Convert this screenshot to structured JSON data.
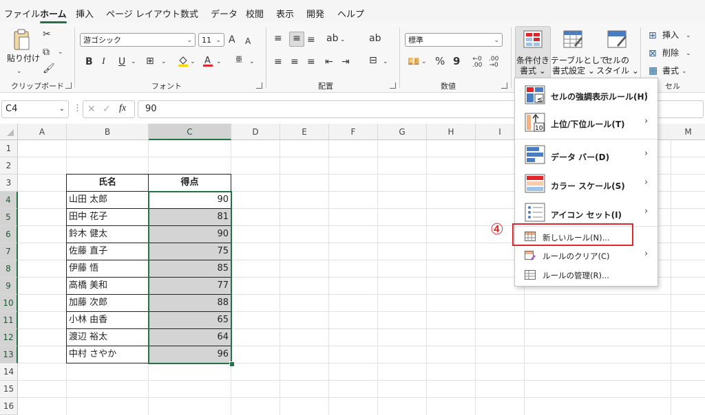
{
  "menu_tabs": [
    "ファイル",
    "ホーム",
    "挿入",
    "ページ レイアウト",
    "数式",
    "データ",
    "校閲",
    "表示",
    "開発",
    "ヘルプ"
  ],
  "active_tab": "ホーム",
  "ribbon": {
    "clipboard": {
      "paste": "貼り付け",
      "group": "クリップボード"
    },
    "font": {
      "name": "游ゴシック",
      "size": "11",
      "bold": "B",
      "italic": "I",
      "underline": "U",
      "group": "フォント",
      "grow": "A",
      "shrink": "A"
    },
    "align": {
      "group": "配置"
    },
    "number": {
      "format": "標準",
      "percent": "%",
      "comma": "9",
      "group": "数値"
    },
    "styles": {
      "cond_format_1": "条件付き",
      "cond_format_2": "書式 ⌄",
      "table_1": "テーブルとして",
      "table_2": "書式設定 ⌄",
      "cell_style_1": "セルの",
      "cell_style_2": "スタイル ⌄"
    },
    "cells": {
      "insert": "挿入",
      "delete": "削除",
      "format": "書式",
      "group": "セル"
    }
  },
  "formula_bar": {
    "name_box": "C4",
    "fx": "fx",
    "value": "90"
  },
  "columns": [
    "A",
    "B",
    "C",
    "D",
    "E",
    "F",
    "G",
    "H",
    "I",
    "M"
  ],
  "rows": [
    "1",
    "2",
    "3",
    "4",
    "5",
    "6",
    "7",
    "8",
    "9",
    "10",
    "11",
    "12",
    "13",
    "14",
    "15",
    "16"
  ],
  "table": {
    "headers": [
      "氏名",
      "得点"
    ],
    "rows": [
      {
        "name": "山田 太郎",
        "score": "90"
      },
      {
        "name": "田中 花子",
        "score": "81"
      },
      {
        "name": "鈴木 健太",
        "score": "90"
      },
      {
        "name": "佐藤 直子",
        "score": "75"
      },
      {
        "name": "伊藤 悟",
        "score": "85"
      },
      {
        "name": "高橋 美和",
        "score": "77"
      },
      {
        "name": "加藤 次郎",
        "score": "88"
      },
      {
        "name": "小林 由香",
        "score": "65"
      },
      {
        "name": "渡辺 裕太",
        "score": "64"
      },
      {
        "name": "中村 さやか",
        "score": "96"
      }
    ]
  },
  "cf_menu": {
    "items": [
      "セルの強調表示ルール(H)",
      "上位/下位ルール(T)",
      "データ バー(D)",
      "カラー スケール(S)",
      "アイコン セット(I)",
      "新しいルール(N)...",
      "ルールのクリア(C)",
      "ルールの管理(R)..."
    ],
    "step_marker": "④",
    "icon_number": "10"
  },
  "colors": {
    "accent": "#217346",
    "highlight": "#e0262a",
    "selection": "#d4d4d4"
  }
}
